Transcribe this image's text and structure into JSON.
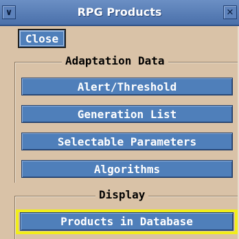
{
  "window": {
    "title": "RPG Products",
    "menu_icon": "chevron-down-icon",
    "close_icon": "close-icon",
    "menu_glyph": "∨",
    "close_glyph": "✕"
  },
  "toolbar": {
    "close_label": "Close"
  },
  "adaptation": {
    "legend": "Adaptation Data",
    "buttons": [
      {
        "label": "Alert/Threshold"
      },
      {
        "label": "Generation List"
      },
      {
        "label": "Selectable Parameters"
      },
      {
        "label": "Algorithms"
      }
    ]
  },
  "display": {
    "legend": "Display",
    "products_label": "Products in Database",
    "highlight_color": "#f1ee1a"
  },
  "colors": {
    "background": "#d9c2a7",
    "button": "#4f7fba",
    "titlebar": "#4a70aa"
  }
}
